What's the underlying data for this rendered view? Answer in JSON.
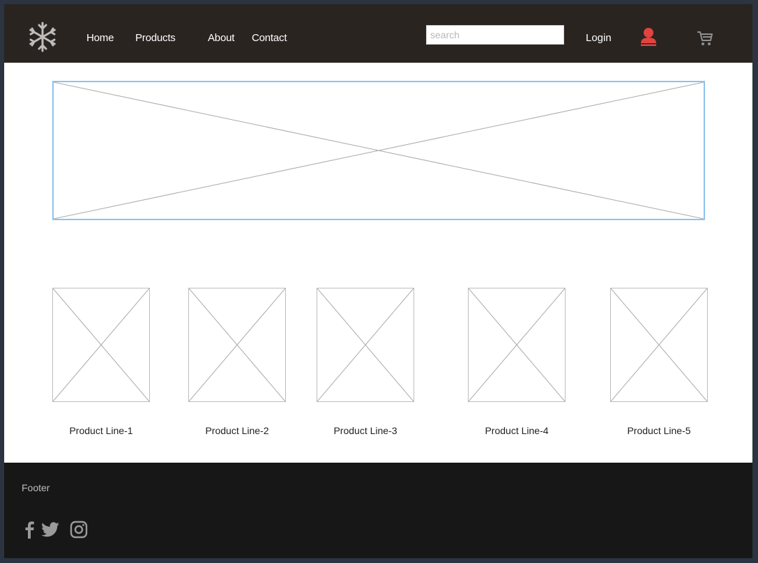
{
  "header": {
    "logo_icon": "snowflake-icon",
    "nav": [
      {
        "label": "Home"
      },
      {
        "label": "Products"
      },
      {
        "label": "About"
      },
      {
        "label": "Contact"
      }
    ],
    "search": {
      "placeholder": "search",
      "value": ""
    },
    "login_label": "Login",
    "user_icon": "user-icon",
    "cart_icon": "cart-icon",
    "user_icon_color": "#e0443e",
    "background": "#2a2421"
  },
  "banner": {
    "image": "image-placeholder",
    "border_color": "#8dc3ee"
  },
  "products": [
    {
      "label": "Product Line-1"
    },
    {
      "label": "Product Line-2"
    },
    {
      "label": "Product Line-3"
    },
    {
      "label": "Product Line-4"
    },
    {
      "label": "Product Line-5"
    }
  ],
  "footer": {
    "label": "Footer",
    "social_icons": [
      "facebook-icon",
      "twitter-icon",
      "instagram-icon"
    ],
    "background": "#171717"
  }
}
